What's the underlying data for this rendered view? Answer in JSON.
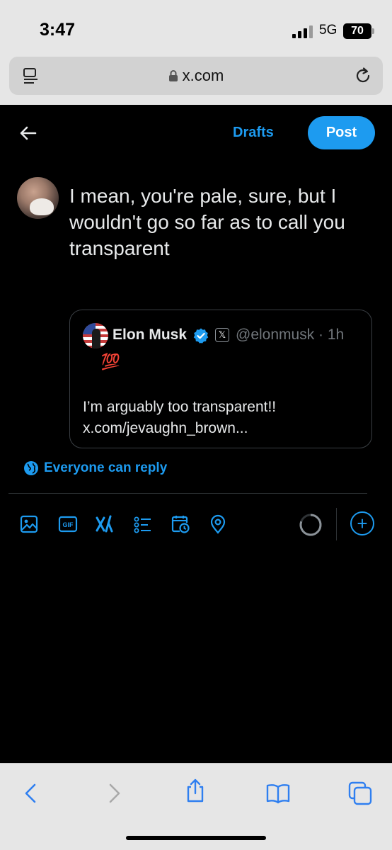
{
  "status_bar": {
    "time": "3:47",
    "network": "5G",
    "battery": "70"
  },
  "browser": {
    "url": "x.com",
    "icons": [
      "reader-icon",
      "lock-icon",
      "reload-icon"
    ]
  },
  "compose": {
    "drafts_label": "Drafts",
    "post_label": "Post",
    "reply_text": "I mean, you're pale, sure, but I wouldn't go so far as to call you transparent",
    "quote": {
      "name": "Elon Musk",
      "affiliate_badge": "𝕏",
      "handle_time": "@elonmusk · 1h",
      "emoji_line": "😂💯",
      "body_line1": "I’m arguably too transparent!!",
      "body_line2": "x.com/jevaughn_brown..."
    },
    "reply_setting": "Everyone can reply",
    "add_symbol": "+",
    "toolbar_icons": [
      "image-icon",
      "gif-icon",
      "grok-icon",
      "poll-icon",
      "schedule-icon",
      "location-icon"
    ]
  },
  "colors": {
    "accent": "#1d9bf0",
    "background": "#000000",
    "text": "#e7e9ea",
    "muted": "#71767b"
  },
  "safari_toolbar": {
    "icons": [
      "back-icon",
      "forward-icon",
      "share-icon",
      "bookmarks-icon",
      "tabs-icon"
    ]
  }
}
